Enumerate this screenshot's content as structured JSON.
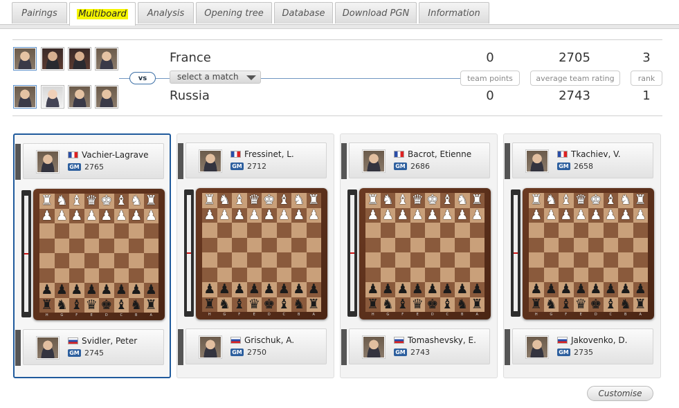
{
  "tabs": [
    "Pairings",
    "Multiboard",
    "Analysis",
    "Opening tree",
    "Database",
    "Download PGN",
    "Information"
  ],
  "active_tab": "Multiboard",
  "match": {
    "vs_label": "vs",
    "select_label": "select a match",
    "team1": {
      "name": "France",
      "team_points": "0",
      "avg_rating": "2705",
      "rank": "3"
    },
    "team2": {
      "name": "Russia",
      "team_points": "0",
      "avg_rating": "2743",
      "rank": "1"
    },
    "labels": {
      "team_points": "team points",
      "avg_rating": "average team rating",
      "rank": "rank"
    }
  },
  "boards": [
    {
      "top": {
        "name": "Vachier-Lagrave",
        "title": "GM",
        "rating": "2765",
        "flag": "fr"
      },
      "bottom": {
        "name": "Svidler, Peter",
        "title": "GM",
        "rating": "2745",
        "flag": "ru"
      }
    },
    {
      "top": {
        "name": "Fressinet, L.",
        "title": "GM",
        "rating": "2712",
        "flag": "fr"
      },
      "bottom": {
        "name": "Grischuk, A.",
        "title": "GM",
        "rating": "2750",
        "flag": "ru"
      }
    },
    {
      "top": {
        "name": "Bacrot, Etienne",
        "title": "GM",
        "rating": "2686",
        "flag": "fr"
      },
      "bottom": {
        "name": "Tomashevsky, E.",
        "title": "GM",
        "rating": "2743",
        "flag": "ru"
      }
    },
    {
      "top": {
        "name": "Tkachiev, V.",
        "title": "GM",
        "rating": "2658",
        "flag": "fr"
      },
      "bottom": {
        "name": "Jakovenko, D.",
        "title": "GM",
        "rating": "2735",
        "flag": "ru"
      }
    }
  ],
  "files": [
    "H",
    "G",
    "F",
    "E",
    "D",
    "C",
    "B",
    "A"
  ],
  "customise_label": "Customise"
}
